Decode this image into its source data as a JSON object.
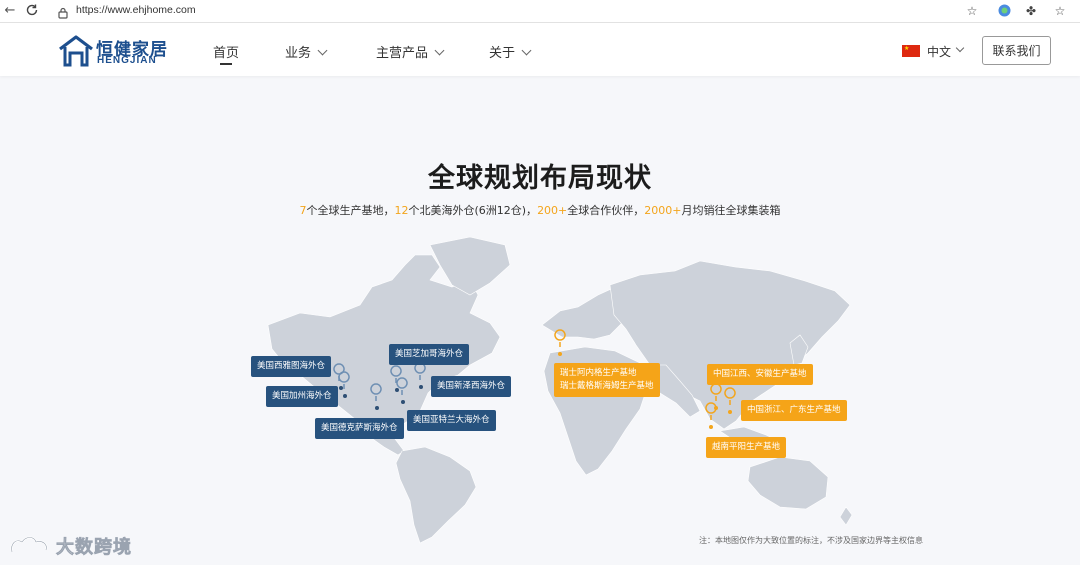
{
  "browser": {
    "url": "https://www.ehjhome.com"
  },
  "header": {
    "logo_cn": "恒健家居",
    "logo_en": "HENGJIAN",
    "nav": [
      {
        "label": "首页",
        "active": true,
        "has_dropdown": false
      },
      {
        "label": "业务",
        "active": false,
        "has_dropdown": true
      },
      {
        "label": "主营产品",
        "active": false,
        "has_dropdown": true
      },
      {
        "label": "关于",
        "active": false,
        "has_dropdown": true
      }
    ],
    "language": "中文",
    "contact_button": "联系我们"
  },
  "section": {
    "title": "全球规划布局现状",
    "subtitle": {
      "n1": "7",
      "t1": "个全球生产基地，",
      "n2": "12",
      "t2": "个北美海外仓(6洲12仓)，",
      "n3": "200+",
      "t3": "全球合作伙伴，",
      "n4": "2000+",
      "t4": "月均销往全球集装箱"
    }
  },
  "map": {
    "warehouses": [
      {
        "label": "美国西雅图海外仓"
      },
      {
        "label": "美国芝加哥海外仓"
      },
      {
        "label": "美国加州海外仓"
      },
      {
        "label": "美国新泽西海外仓"
      },
      {
        "label": "美国德克萨斯海外仓"
      },
      {
        "label": "美国亚特兰大海外仓"
      }
    ],
    "bases": [
      {
        "label_line1": "瑞士阿内格生产基地",
        "label_line2": "瑞士戴格斯海姆生产基地"
      },
      {
        "label": "中国江西、安徽生产基地"
      },
      {
        "label": "中国浙江、广东生产基地"
      },
      {
        "label": "越南平阳生产基地"
      }
    ],
    "note": "注：本地图仅作为大致位置的标注，不涉及国家边界等主权信息",
    "colors": {
      "land": "#cdd2da",
      "warehouse_tag": "#27527e",
      "base_tag": "#f5a418"
    }
  },
  "watermark": {
    "text": "大数跨境"
  }
}
